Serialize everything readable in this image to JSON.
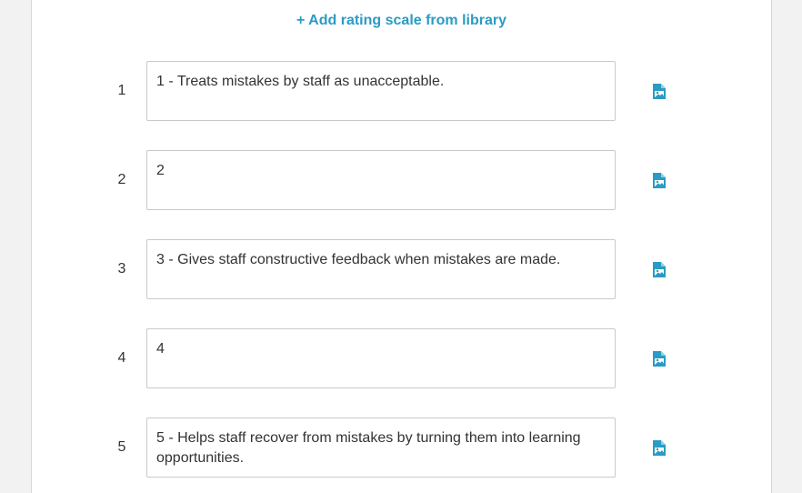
{
  "add_link_label": "+ Add rating scale from library",
  "accent_color": "#2a9bc4",
  "rows": [
    {
      "number": "1",
      "text": "1 - Treats mistakes by staff as unacceptable.",
      "icon": "image-file-icon"
    },
    {
      "number": "2",
      "text": "2",
      "icon": "image-file-icon"
    },
    {
      "number": "3",
      "text": "3 - Gives staff constructive feedback when mistakes are made.",
      "icon": "image-file-icon"
    },
    {
      "number": "4",
      "text": "4",
      "icon": "image-file-icon"
    },
    {
      "number": "5",
      "text": "5 - Helps staff recover from mistakes by turning them into learning opportunities.",
      "icon": "image-file-icon"
    }
  ]
}
